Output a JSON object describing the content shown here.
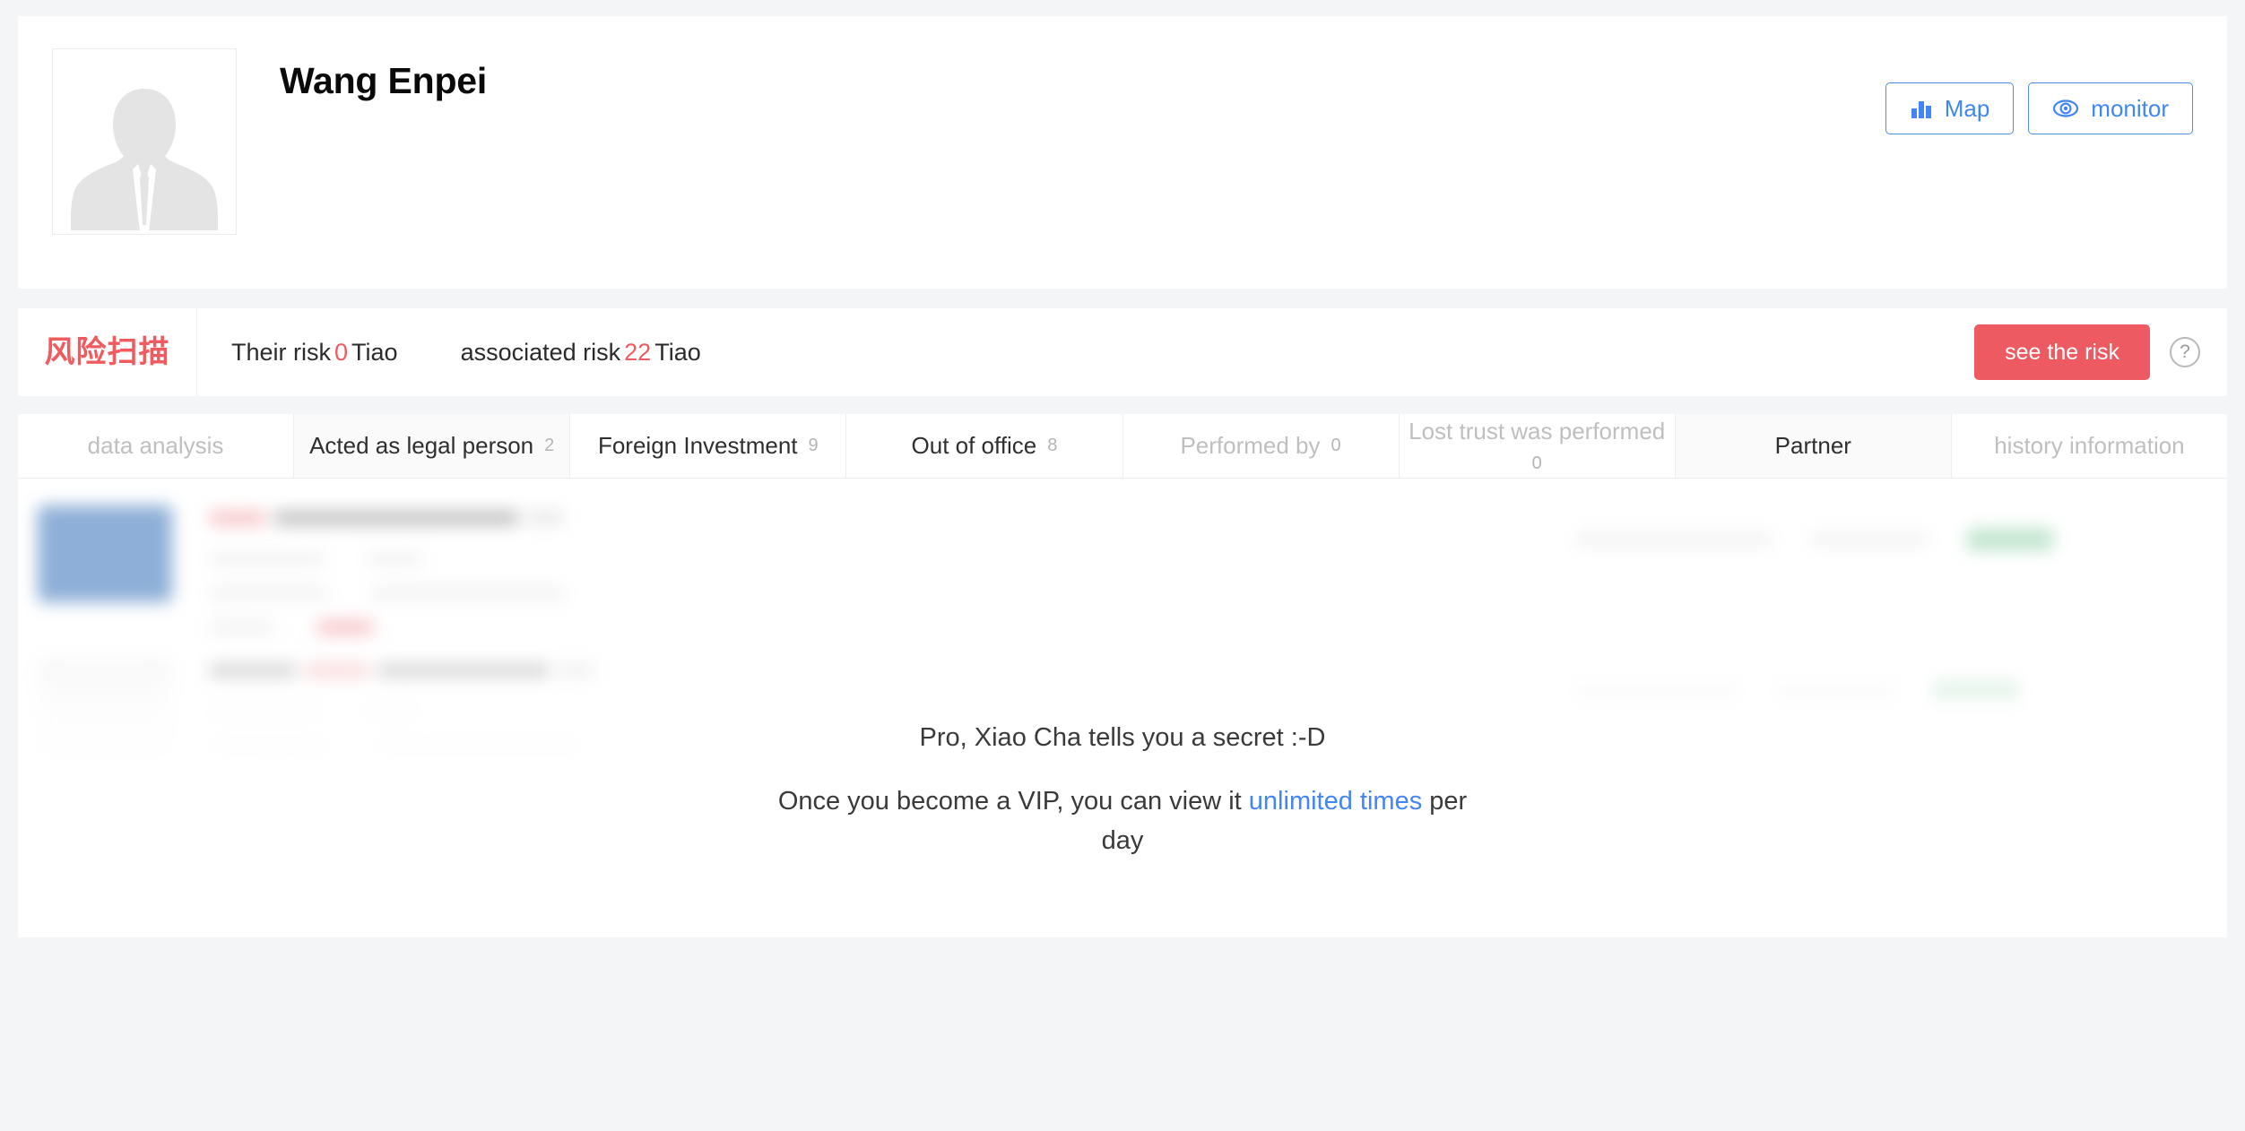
{
  "profile": {
    "name": "Wang Enpei",
    "avatar_icon": "person-placeholder-icon",
    "actions": [
      {
        "label": "Map",
        "icon": "bar-chart-icon"
      },
      {
        "label": "monitor",
        "icon": "eye-icon"
      }
    ]
  },
  "risk_bar": {
    "logo_text": "风险扫描",
    "logo_color": "#ef5b5f",
    "stats": [
      {
        "prefix": "Their risk",
        "value": "0",
        "suffix": "Tiao"
      },
      {
        "prefix": "associated risk",
        "value": "22",
        "suffix": "Tiao"
      }
    ],
    "action_label": "see the risk",
    "action_color": "#ee5a62",
    "help_icon": "question-mark-icon",
    "help_label": "?"
  },
  "tabs": [
    {
      "label": "data analysis",
      "count": "",
      "state": "muted"
    },
    {
      "label": "Acted as legal person",
      "count": "2",
      "state": "active",
      "wrap": true
    },
    {
      "label": "Foreign Investment",
      "count": "9",
      "state": "dark"
    },
    {
      "label": "Out of office",
      "count": "8",
      "state": "dark"
    },
    {
      "label": "Performed by",
      "count": "0",
      "state": "muted"
    },
    {
      "label": "Lost trust was performed",
      "count": "0",
      "state": "muted",
      "wrap": true
    },
    {
      "label": "Partner",
      "count": "",
      "state": "active"
    },
    {
      "label": "history information",
      "count": "",
      "state": "muted"
    }
  ],
  "list": {
    "rows": [
      {
        "avatar_tone": "blue"
      },
      {
        "avatar_tone": "grey"
      },
      {
        "avatar_tone": "gold"
      }
    ]
  },
  "vip_overlay": {
    "line1": "Pro, Xiao Cha tells you a secret :-D",
    "line2_before": "Once you become a VIP, you can view it ",
    "line2_link": "unlimited times",
    "line2_after": " per day",
    "link_color": "#4285f4"
  }
}
